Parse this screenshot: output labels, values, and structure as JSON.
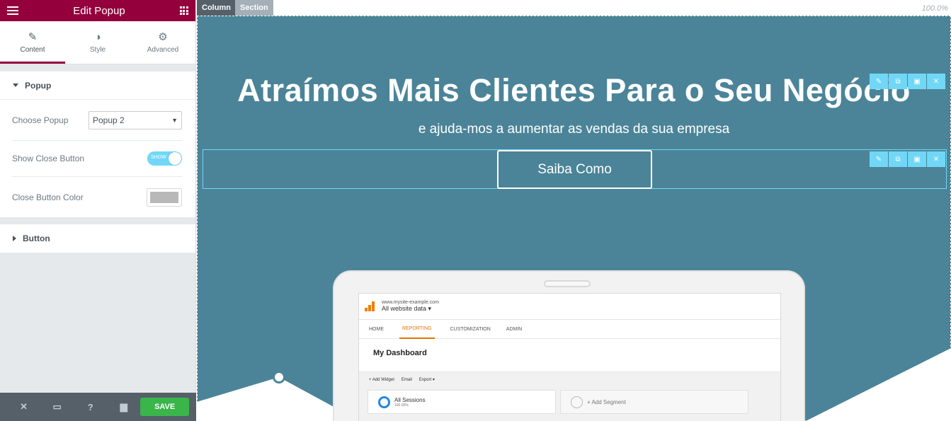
{
  "panel": {
    "title": "Edit Popup",
    "tabs": [
      {
        "label": "Content",
        "icon": "pencil-icon"
      },
      {
        "label": "Style",
        "icon": "contrast-icon"
      },
      {
        "label": "Advanced",
        "icon": "gear-icon"
      }
    ],
    "popup_section": {
      "title": "Popup",
      "choose_popup_label": "Choose Popup",
      "choose_popup_value": "Popup 2",
      "show_close_label": "Show Close Button",
      "show_close_toggle": "SHOW",
      "close_color_label": "Close Button Color",
      "close_color_value": "#b8b8b8"
    },
    "button_section": {
      "title": "Button"
    },
    "footer": {
      "save_label": "SAVE"
    }
  },
  "canvas": {
    "column_label": "Column",
    "section_label": "Section",
    "zoom": "100.0%",
    "headline": "Atraímos Mais Clientes Para o Seu Negócio",
    "subheadline": "e ajuda-mos a aumentar as vendas da sua empresa",
    "cta": "Saiba Como"
  },
  "analytics": {
    "site": "www.mysite-example.com",
    "view": "All website data",
    "nav": [
      "HOME",
      "REPORTING",
      "CUSTOMIZATION",
      "ADMIN"
    ],
    "dashboard_title": "My Dashboard",
    "toolbar": [
      "+ Add Widget",
      "Email",
      "Export"
    ],
    "segment_name": "All Sessions",
    "segment_value": "100.00%",
    "add_segment": "+ Add Segment"
  },
  "colors": {
    "brand": "#93003c",
    "hero_bg": "#4b8498",
    "selection": "#71d7f7",
    "save": "#39b54a"
  }
}
